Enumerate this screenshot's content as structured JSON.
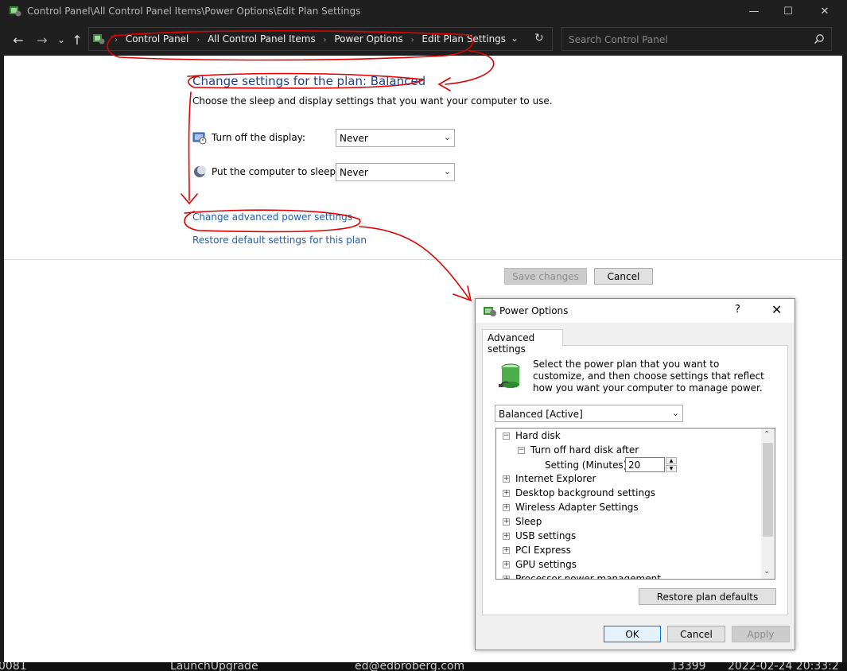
{
  "window": {
    "title": "Control Panel\\All Control Panel Items\\Power Options\\Edit Plan Settings",
    "minimize": "—",
    "maximize": "☐",
    "close": "✕"
  },
  "nav": {
    "back": "←",
    "forward": "→",
    "recent": "⌄",
    "up": "↑",
    "breadcrumbs": [
      "Control Panel",
      "All Control Panel Items",
      "Power Options",
      "Edit Plan Settings"
    ],
    "separator": "›",
    "dropdown": "⌄",
    "refresh": "↻"
  },
  "search": {
    "placeholder": "Search Control Panel"
  },
  "main": {
    "heading": "Change settings for the plan: Balanced",
    "subtext": "Choose the sleep and display settings that you want your computer to use.",
    "settings": [
      {
        "label": "Turn off the display:",
        "value": "Never"
      },
      {
        "label": "Put the computer to sleep:",
        "value": "Never"
      }
    ],
    "links": {
      "advanced": "Change advanced power settings",
      "restore": "Restore default settings for this plan"
    },
    "buttons": {
      "save": "Save changes",
      "cancel": "Cancel"
    }
  },
  "dialog": {
    "title": "Power Options",
    "help": "?",
    "close": "✕",
    "tab": "Advanced settings",
    "description": "Select the power plan that you want to customize, and then choose settings that reflect how you want your computer to manage power.",
    "plan": "Balanced [Active]",
    "tree": {
      "hard_disk": "Hard disk",
      "turn_off": "Turn off hard disk after",
      "setting_label": "Setting (Minutes):",
      "setting_value": "20",
      "items": [
        "Internet Explorer",
        "Desktop background settings",
        "Wireless Adapter Settings",
        "Sleep",
        "USB settings",
        "PCI Express",
        "GPU settings",
        "Processor power management"
      ]
    },
    "restore": "Restore plan defaults",
    "ok": "OK",
    "cancel": "Cancel",
    "apply": "Apply"
  },
  "background_strip": [
    "0081",
    "LaunchUpgrade",
    "ed@edbroberg.com",
    "13399",
    "2022-02-24 20:33:2"
  ],
  "annotation_color": "#e00000"
}
